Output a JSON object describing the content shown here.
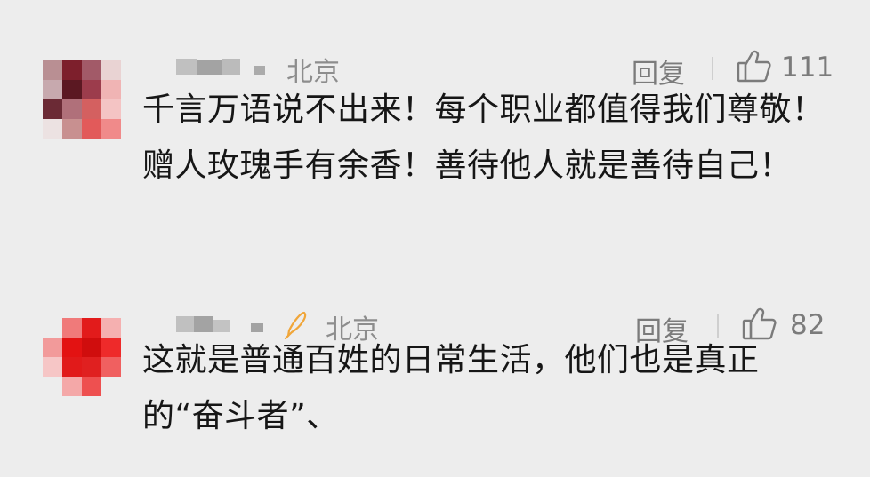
{
  "comments": [
    {
      "location": "北京",
      "reply_label": "回复",
      "like_count": "111",
      "text": "千言万语说不出来！每个职业都值得我们尊敬！赠人玫瑰手有余香！善待他人就是善待自己！",
      "avatar_colors": [
        "#b98f93",
        "#7d1f2c",
        "#a25a68",
        "#e9d3d3",
        "#c7a9ae",
        "#5b1822",
        "#9c3c4c",
        "#f0b4b4",
        "#6b2a35",
        "#b0707a",
        "#d46060",
        "#f4c4c4",
        "#ece2e2",
        "#c89090",
        "#e25a5a",
        "#f08a8a"
      ]
    },
    {
      "location": "北京",
      "reply_label": "回复",
      "like_count": "82",
      "text": "这就是普通百姓的日常生活，他们也是真正的“奋斗者”、",
      "avatar_colors": [
        "#ededed",
        "#f07a7a",
        "#e21b1b",
        "#f5b0b0",
        "#f29a9a",
        "#e31212",
        "#d00d0d",
        "#ee2a2a",
        "#f6c6c6",
        "#e11a1a",
        "#e02020",
        "#f06060",
        "#ededed",
        "#f4a8a8",
        "#ee5050",
        "#ededed"
      ]
    }
  ],
  "colors": {
    "background": "#ededed",
    "meta_text": "#8d8d8d",
    "comment_text": "#161616",
    "pen_icon": "#f0a63a"
  }
}
